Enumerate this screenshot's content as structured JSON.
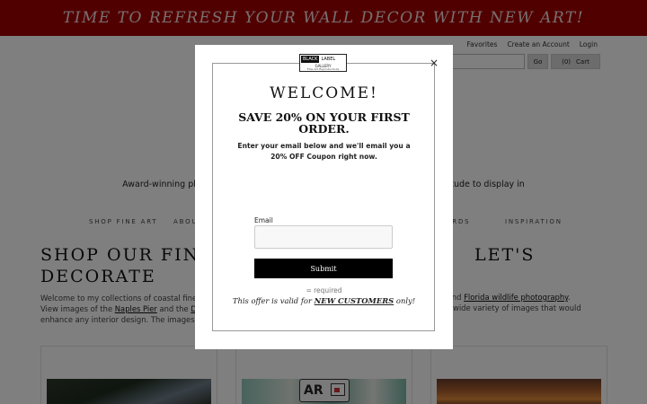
{
  "banner": {
    "text": "TIME TO REFRESH YOUR WALL DECOR WITH NEW ART!"
  },
  "header": {
    "links": [
      "Favorites",
      "Create an Account",
      "Login"
    ],
    "search_button": "Go",
    "cart_count": "(0)",
    "cart_label": "Cart"
  },
  "tagline": {
    "left": "Award-winning pho",
    "right": "olitude to display in"
  },
  "nav": [
    "SHOP FINE ART",
    "ABOU",
    "CARDS",
    "INSPIRATION"
  ],
  "main": {
    "heading_line1_left": "SHOP OUR FINE",
    "heading_line1_right": "LET'S",
    "heading_line2": "DECORATE",
    "intro_line1": "Welcome to my collections of coastal fine a",
    "intro_line2_a": "View images of the ",
    "intro_line2_link1": "Naples Pier",
    "intro_line2_b": " and the ",
    "intro_line2_link2": "De",
    "intro_line3": "enhance any interior design. The images a",
    "intro_right1_link": "phs",
    "intro_right1_and": " and ",
    "intro_right1_link2": "Florida wildlife photography",
    "intro_right1_end": ".",
    "intro_right2": " wide variety of images that would"
  },
  "ar_badge": "AR",
  "modal": {
    "logo_black": "BLACK",
    "logo_white": "LABEL",
    "logo_gallery": "GALLERY",
    "logo_sub": "Fine Art Reproductions",
    "close": "×",
    "welcome": "WELCOME!",
    "save": "SAVE 20% ON YOUR FIRST ORDER.",
    "description": "Enter your email below and we'll email you a 20% OFF Coupon right now.",
    "email_label": "Email",
    "submit": "Submit",
    "required": "= required",
    "offer_prefix": "This offer is valid for ",
    "offer_strong": "NEW CUSTOMERS",
    "offer_suffix": " only!"
  }
}
